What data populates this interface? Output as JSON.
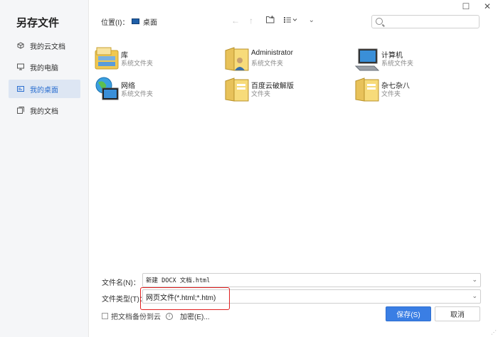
{
  "dialog": {
    "title": "另存文件"
  },
  "sidebar": {
    "items": [
      {
        "label": "我的云文档",
        "icon": "cloud-doc-icon",
        "active": false
      },
      {
        "label": "我的电脑",
        "icon": "computer-icon",
        "active": false
      },
      {
        "label": "我的桌面",
        "icon": "desktop-icon",
        "active": true
      },
      {
        "label": "我的文档",
        "icon": "documents-icon",
        "active": false
      }
    ]
  },
  "toolbar": {
    "location_label": "位置(I)：",
    "location_value": "桌面"
  },
  "files": [
    {
      "name": "库",
      "type": "系统文件夹",
      "icon": "library-icon"
    },
    {
      "name": "Administrator",
      "type": "系统文件夹",
      "icon": "user-folder-icon"
    },
    {
      "name": "计算机",
      "type": "系统文件夹",
      "icon": "computer-icon"
    },
    {
      "name": "网络",
      "type": "系统文件夹",
      "icon": "network-icon"
    },
    {
      "name": "百度云破解版",
      "type": "文件夹",
      "icon": "folder-icon"
    },
    {
      "name": "杂七杂八",
      "type": "文件夹",
      "icon": "folder-icon"
    }
  ],
  "form": {
    "filename_label": "文件名(N)：",
    "filename_value": "新建 DOCX 文档.html",
    "filetype_label": "文件类型(T)：",
    "filetype_value": "网页文件(*.html;*.htm)",
    "backup_label": "把文档备份到云",
    "encrypt_label": "加密(E)...",
    "save_label": "保存(S)",
    "cancel_label": "取消"
  },
  "colors": {
    "accent": "#3a7ee4",
    "highlight_border": "#e02020",
    "active_sidebar_bg": "#dde6f3"
  }
}
